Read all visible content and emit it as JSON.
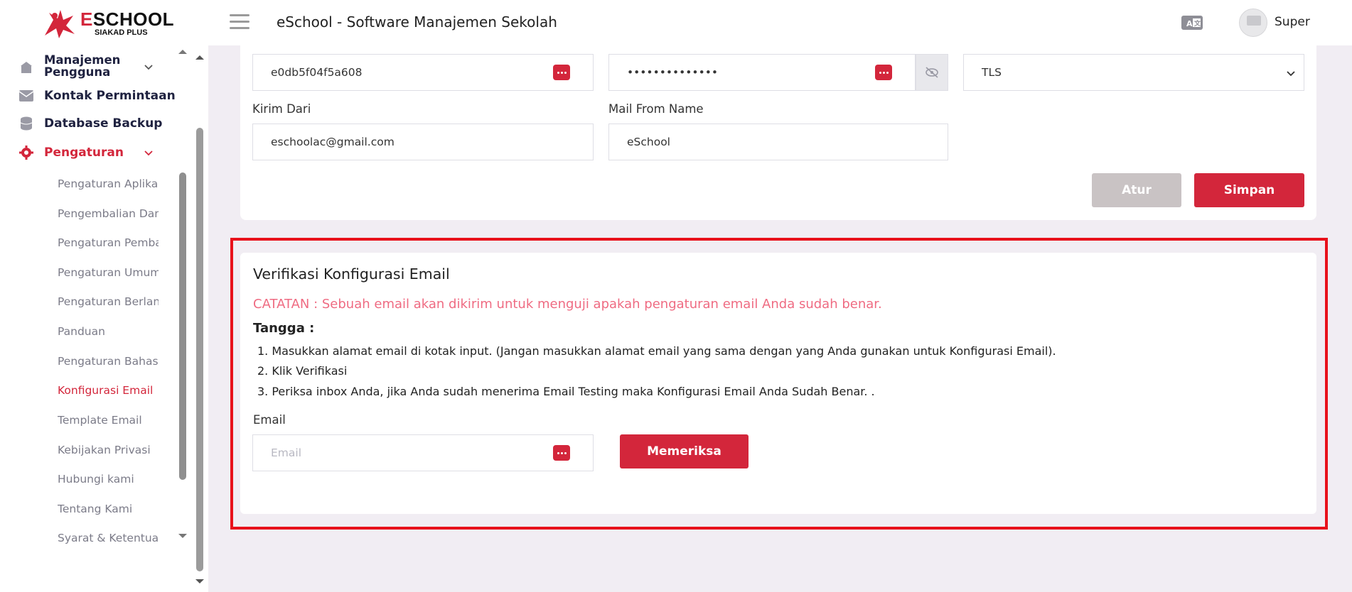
{
  "header": {
    "logo_main": "SCHOOL",
    "logo_initial": "E",
    "logo_sub": "SIAKAD PLUS",
    "title": "eSchool - Software Manajemen Sekolah",
    "user_name": "Super"
  },
  "sidebar": {
    "items": [
      {
        "label": "Manajemen Pengguna",
        "icon": "users-icon"
      },
      {
        "label": "Kontak Permintaan",
        "icon": "envelope-icon"
      },
      {
        "label": "Database Backup",
        "icon": "database-icon"
      },
      {
        "label": "Pengaturan",
        "icon": "gear-icon"
      }
    ],
    "sub_items": [
      "Pengaturan Aplikasi",
      "Pengembalian Dana",
      "Pengaturan Pembayaran",
      "Pengaturan Umum",
      "Pengaturan Berlangganan",
      "Panduan",
      "Pengaturan Bahasa",
      "Konfigurasi Email",
      "Template Email",
      "Kebijakan Privasi",
      "Hubungi kami",
      "Tentang Kami",
      "Syarat & Ketentuan"
    ],
    "active_sub": "Konfigurasi Email",
    "accent_color": "#d3263b"
  },
  "smtp": {
    "username_value": "e0db5f04f5a608",
    "password_value": "••••••••••••••",
    "encryption_value": "TLS",
    "from_label": "Kirim Dari",
    "from_value": "eschoolac@gmail.com",
    "from_name_label": "Mail From Name",
    "from_name_value": "eSchool",
    "reset_label": "Atur",
    "save_label": "Simpan"
  },
  "verify": {
    "title": "Verifikasi Konfigurasi Email",
    "note": "CATATAN : Sebuah email akan dikirim untuk menguji apakah pengaturan email Anda sudah benar.",
    "steps_title": "Tangga :",
    "steps": [
      "1. Masukkan alamat email di kotak input. (Jangan masukkan alamat email yang sama dengan yang Anda gunakan untuk Konfigurasi Email).",
      "2. Klik Verifikasi",
      "3. Periksa inbox Anda, jika Anda sudah menerima Email Testing maka Konfigurasi Email Anda Sudah Benar. ."
    ],
    "email_label": "Email",
    "email_placeholder": "Email",
    "check_label": "Memeriksa"
  }
}
